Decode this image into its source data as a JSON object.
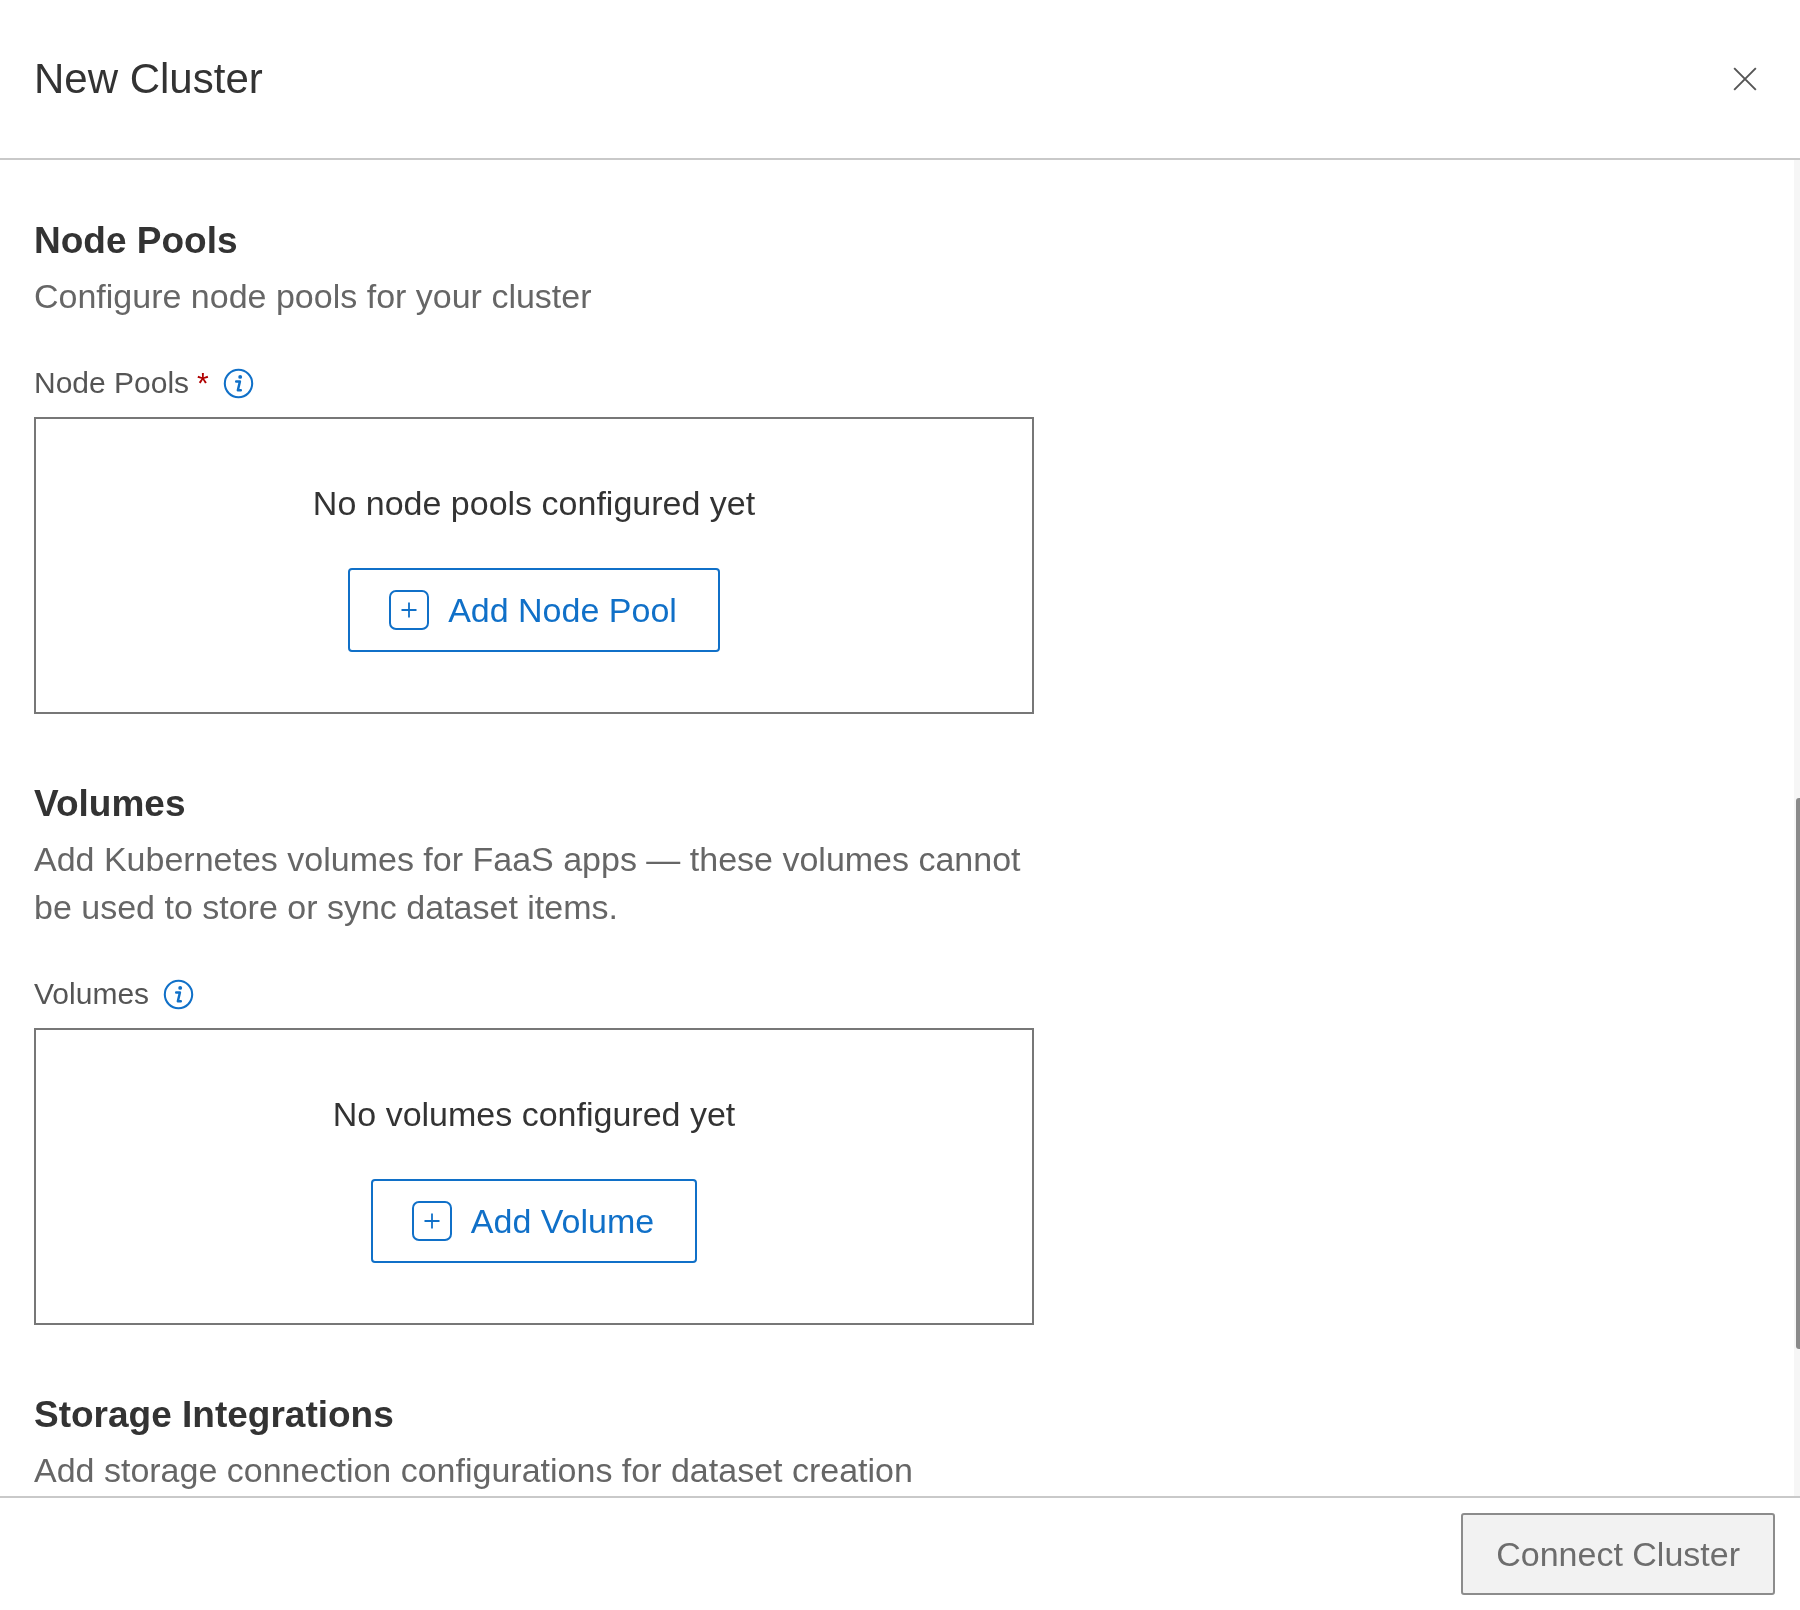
{
  "dialog": {
    "title": "New Cluster"
  },
  "sections": [
    {
      "heading": "Node Pools",
      "description": "Configure node pools for your cluster",
      "field": {
        "label": "Node Pools",
        "required_marker": "*",
        "empty_message": "No node pools configured yet",
        "add_button": "Add Node Pool"
      }
    },
    {
      "heading": "Volumes",
      "description": "Add Kubernetes volumes for FaaS apps — these volumes cannot be used to store or sync dataset items.",
      "field": {
        "label": "Volumes",
        "empty_message": "No volumes configured yet",
        "add_button": "Add Volume"
      }
    },
    {
      "heading": "Storage Integrations",
      "description": "Add storage connection configurations for dataset creation"
    }
  ],
  "footer": {
    "primary_button": {
      "label": "Connect Cluster",
      "disabled": true
    }
  }
}
